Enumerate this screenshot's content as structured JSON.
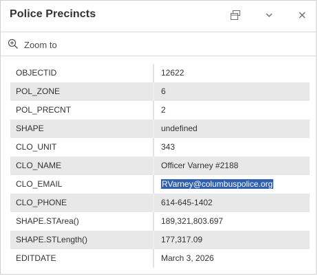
{
  "popup": {
    "title": "Police Precincts",
    "dock_icon": "dock-icon",
    "collapse_icon": "chevron-down-icon",
    "close_icon": "close-icon"
  },
  "actions": {
    "zoom_label": "Zoom to",
    "zoom_icon": "zoom-in-icon"
  },
  "attributes": [
    {
      "field": "OBJECTID",
      "value": "12622"
    },
    {
      "field": "POL_ZONE",
      "value": "6"
    },
    {
      "field": "POL_PRECNT",
      "value": "2"
    },
    {
      "field": "SHAPE",
      "value": "undefined"
    },
    {
      "field": "CLO_UNIT",
      "value": "343"
    },
    {
      "field": "CLO_NAME",
      "value": "Officer Varney #2188"
    },
    {
      "field": "CLO_EMAIL",
      "value": "RVarney@columbuspolice.org"
    },
    {
      "field": "CLO_PHONE",
      "value": "614-645-1402"
    },
    {
      "field": "SHAPE.STArea()",
      "value": "189,321,803.697"
    },
    {
      "field": "SHAPE.STLength()",
      "value": "177,317.09"
    },
    {
      "field": "EDITDATE",
      "value": "March 3, 2026"
    }
  ],
  "colors": {
    "selection": "#2f5fb3",
    "alt_row": "#e8e8e8"
  }
}
